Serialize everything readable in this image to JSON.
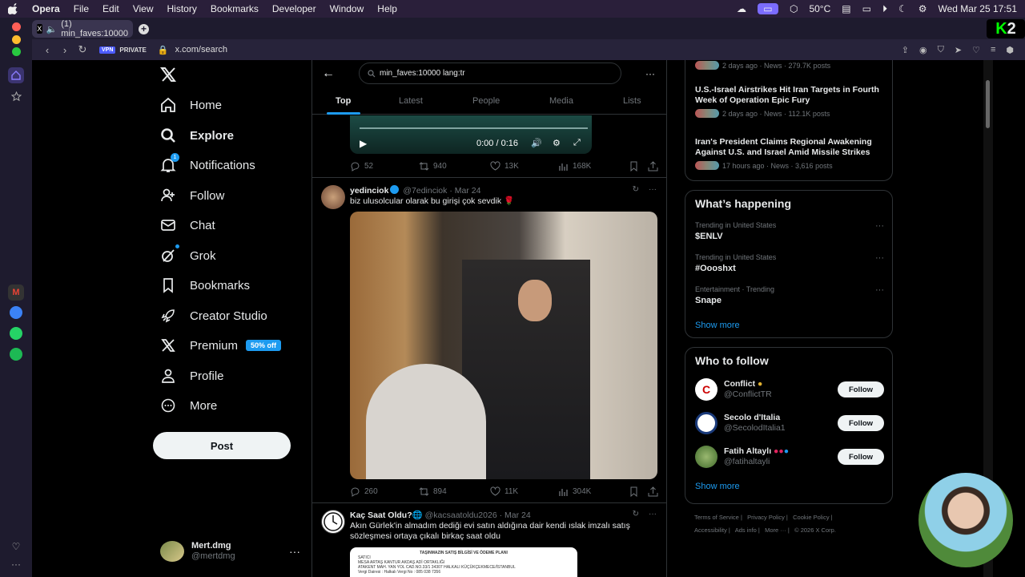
{
  "menubar": {
    "app": "Opera",
    "items": [
      "File",
      "Edit",
      "View",
      "History",
      "Bookmarks",
      "Developer",
      "Window",
      "Help"
    ],
    "temp": "50°C",
    "datetime": "Wed Mar 25  17:51"
  },
  "browser": {
    "tab_title": "(1) min_faves:10000",
    "vpn": "VPN",
    "private": "PRIVATE",
    "url": "x.com/search",
    "brand": "2"
  },
  "nav": {
    "items": [
      {
        "label": "Home",
        "icon": "home-icon"
      },
      {
        "label": "Explore",
        "icon": "search-icon"
      },
      {
        "label": "Notifications",
        "icon": "bell-icon",
        "badge": "1"
      },
      {
        "label": "Follow",
        "icon": "add-person-icon"
      },
      {
        "label": "Chat",
        "icon": "mail-icon"
      },
      {
        "label": "Grok",
        "icon": "grok-icon"
      },
      {
        "label": "Bookmarks",
        "icon": "bookmark-icon"
      },
      {
        "label": "Creator Studio",
        "icon": "rocket-icon"
      },
      {
        "label": "Premium",
        "icon": "x-icon",
        "badge": "50% off"
      },
      {
        "label": "Profile",
        "icon": "person-icon"
      },
      {
        "label": "More",
        "icon": "more-circle-icon"
      }
    ],
    "post_label": "Post",
    "account": {
      "name": "Mert.dmg",
      "handle": "@mertdmg"
    }
  },
  "search": {
    "query": "min_faves:10000 lang:tr",
    "tabs": [
      "Top",
      "Latest",
      "People",
      "Media",
      "Lists"
    ],
    "active_tab": "Top"
  },
  "tweets": [
    {
      "video": {
        "time": "0:00 / 0:16"
      },
      "stats": {
        "replies": "52",
        "reposts": "940",
        "likes": "13K",
        "views": "168K"
      }
    },
    {
      "name": "yedinciok",
      "handle": "@7edinciok",
      "date": "Mar 24",
      "text": "biz ulusolcular olarak bu girişi çok sevdik 🌹",
      "stats": {
        "replies": "260",
        "reposts": "894",
        "likes": "11K",
        "views": "304K"
      }
    },
    {
      "name": "Kaç Saat Oldu?",
      "handle": "@kacsaatoldu2026",
      "date": "Mar 24",
      "text": "Akın Gürlek'in almadım dediği evi satın aldığına dair kendi ıslak imzalı satış sözleşmesi ortaya çıkalı birkaç saat oldu",
      "doc_lines": [
        "TAŞINMAZIN SATIŞ BİLGİSİ VE ÖDEME PLANI",
        "SATICI",
        "MESA ARTAŞ KANTUR AKDAŞ ADİ ORTAKLIĞI",
        "ATAKENT MAH. YAN YOL CAD.NO.33/1 34307 HALKALI KÜÇÜKÇEKMECE/İSTANBUL",
        "Vergi Dairesi : Halkalı     Vergi No : 085 038 7356"
      ]
    }
  ],
  "news": [
    {
      "title": "",
      "meta": "2 days ago · News · 279.7K posts"
    },
    {
      "title": "U.S.-Israel Airstrikes Hit Iran Targets in Fourth Week of Operation Epic Fury",
      "meta": "2 days ago · News · 112.1K posts"
    },
    {
      "title": "Iran's President Claims Regional Awakening Against U.S. and Israel Amid Missile Strikes",
      "meta": "17 hours ago · News · 3,616 posts"
    }
  ],
  "happening": {
    "title": "What’s happening",
    "trends": [
      {
        "context": "Trending in United States",
        "name": "$ENLV"
      },
      {
        "context": "Trending in United States",
        "name": "#Oooshxt"
      },
      {
        "context": "Entertainment · Trending",
        "name": "Snape"
      }
    ],
    "show_more": "Show more"
  },
  "who_to_follow": {
    "title": "Who to follow",
    "accounts": [
      {
        "name": "Conflict",
        "handle": "@ConflictTR",
        "button": "Follow"
      },
      {
        "name": "Secolo d'Italia",
        "handle": "@SecolodItalia1",
        "button": "Follow"
      },
      {
        "name": "Fatih Altaylı",
        "handle": "@fatihaltayli",
        "button": "Follow"
      }
    ],
    "show_more": "Show more"
  },
  "footer": {
    "links": [
      "Terms of Service",
      "Privacy Policy",
      "Cookie Policy",
      "Accessibility",
      "Ads info",
      "More ···",
      "© 2026 X Corp."
    ]
  },
  "colors": {
    "accent": "#1d9bf0",
    "bg": "#000000",
    "border": "#2f3336",
    "muted": "#71767b"
  }
}
